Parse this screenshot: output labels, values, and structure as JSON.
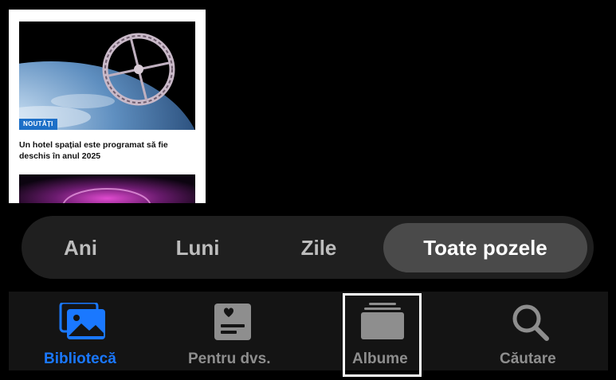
{
  "thumbnail": {
    "badge": "NOUTĂȚI",
    "headline": "Un hotel spațial este programat să fie deschis în anul 2025"
  },
  "segmented_control": {
    "items": [
      {
        "label": "Ani",
        "selected": false
      },
      {
        "label": "Luni",
        "selected": false
      },
      {
        "label": "Zile",
        "selected": false
      },
      {
        "label": "Toate pozele",
        "selected": true
      }
    ]
  },
  "tab_bar": {
    "items": [
      {
        "label": "Bibliotecă",
        "icon": "photos-library-icon",
        "active": true
      },
      {
        "label": "Pentru dvs.",
        "icon": "for-you-icon",
        "active": false
      },
      {
        "label": "Albume",
        "icon": "albums-icon",
        "active": false,
        "focused": true
      },
      {
        "label": "Căutare",
        "icon": "search-icon",
        "active": false
      }
    ]
  },
  "colors": {
    "accent": "#1a78ff",
    "inactive": "#8e8e8e",
    "badge": "#1d6fc7"
  }
}
